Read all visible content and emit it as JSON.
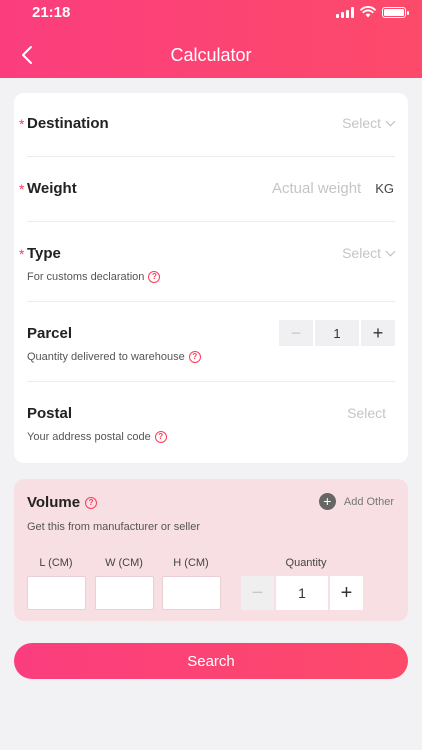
{
  "status_bar": {
    "time": "21:18"
  },
  "header": {
    "title": "Calculator"
  },
  "form": {
    "destination": {
      "required": "*",
      "label": "Destination",
      "value": "Select"
    },
    "weight": {
      "required": "*",
      "label": "Weight",
      "placeholder": "Actual weight",
      "unit": "KG"
    },
    "type": {
      "required": "*",
      "label": "Type",
      "value": "Select",
      "hint": "For customs declaration"
    },
    "parcel": {
      "label": "Parcel",
      "hint": "Quantity delivered to warehouse",
      "quantity": "1",
      "minus": "−",
      "plus": "+"
    },
    "postal": {
      "label": "Postal",
      "value": "Select",
      "hint": "Your address postal code"
    }
  },
  "volume": {
    "label": "Volume",
    "add_label": "Add Other",
    "add_icon": "+",
    "hint": "Get this from manufacturer or seller",
    "length_label": "L (CM)",
    "width_label": "W (CM)",
    "height_label": "H (CM)",
    "quantity_label": "Quantity",
    "quantity": "1",
    "minus": "−",
    "plus": "+"
  },
  "search_button": "Search",
  "help_glyph": "?",
  "colors": {
    "accent": "#fb3d7e",
    "volume_bg": "#f7dfe3"
  }
}
